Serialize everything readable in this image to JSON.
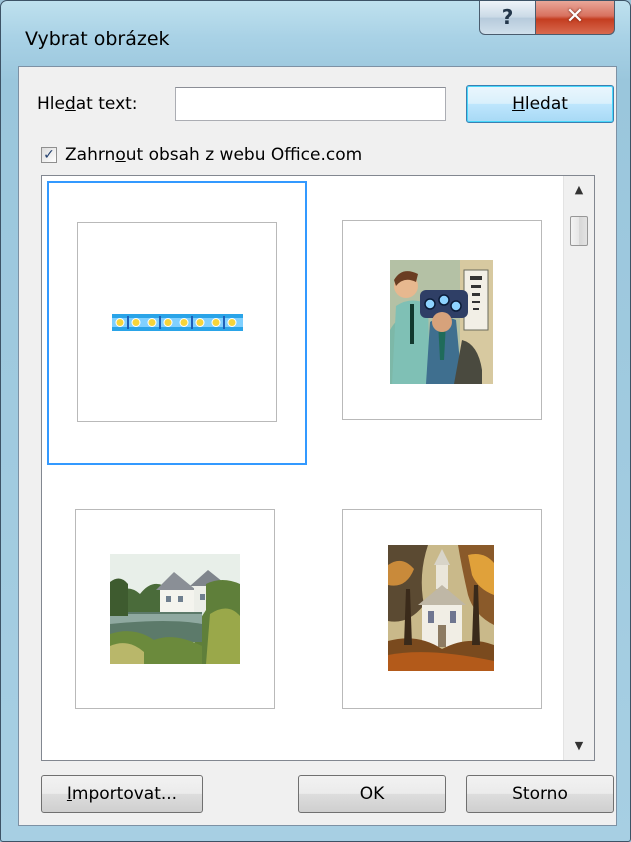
{
  "window": {
    "title": "Vybrat obrázek",
    "help_glyph": "?",
    "close_glyph": "✕"
  },
  "search": {
    "label_prefix": "Hle",
    "label_accel": "d",
    "label_suffix": "at text:",
    "value": "",
    "placeholder": "",
    "button_accel": "H",
    "button_rest": "ledat"
  },
  "include_online": {
    "checked": true,
    "label_prefix": "Zahrn",
    "label_accel": "o",
    "label_suffix": "ut obsah z webu Office.com"
  },
  "gallery": {
    "items": [
      {
        "icon": "flower-border-clipart-icon",
        "selected": true
      },
      {
        "icon": "eye-exam-clipart-icon",
        "selected": false
      },
      {
        "icon": "lake-house-clipart-icon",
        "selected": false
      },
      {
        "icon": "church-autumn-clipart-icon",
        "selected": false
      }
    ],
    "scroll_up_glyph": "▲",
    "scroll_down_glyph": "▼"
  },
  "buttons": {
    "import_accel": "I",
    "import_rest": "mportovat...",
    "ok": "OK",
    "cancel": "Storno"
  },
  "colors": {
    "selection_border": "#3399ff",
    "close_button": "#c43d20",
    "frame_accent": "#a9d2e6"
  }
}
